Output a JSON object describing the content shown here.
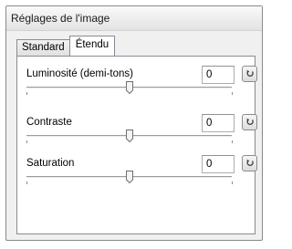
{
  "window": {
    "title": "Réglages de l'image"
  },
  "tabs": [
    {
      "label": "Standard",
      "active": false
    },
    {
      "label": "Étendu",
      "active": true
    }
  ],
  "settings": [
    {
      "label": "Luminosité (demi-tons)",
      "value": "0",
      "slider_position": 0.5
    },
    {
      "label": "Contraste",
      "value": "0",
      "slider_position": 0.5
    },
    {
      "label": "Saturation",
      "value": "0",
      "slider_position": 0.5
    }
  ],
  "icons": {
    "reset": "reset-arrow-icon",
    "thumb": "slider-thumb-icon"
  }
}
